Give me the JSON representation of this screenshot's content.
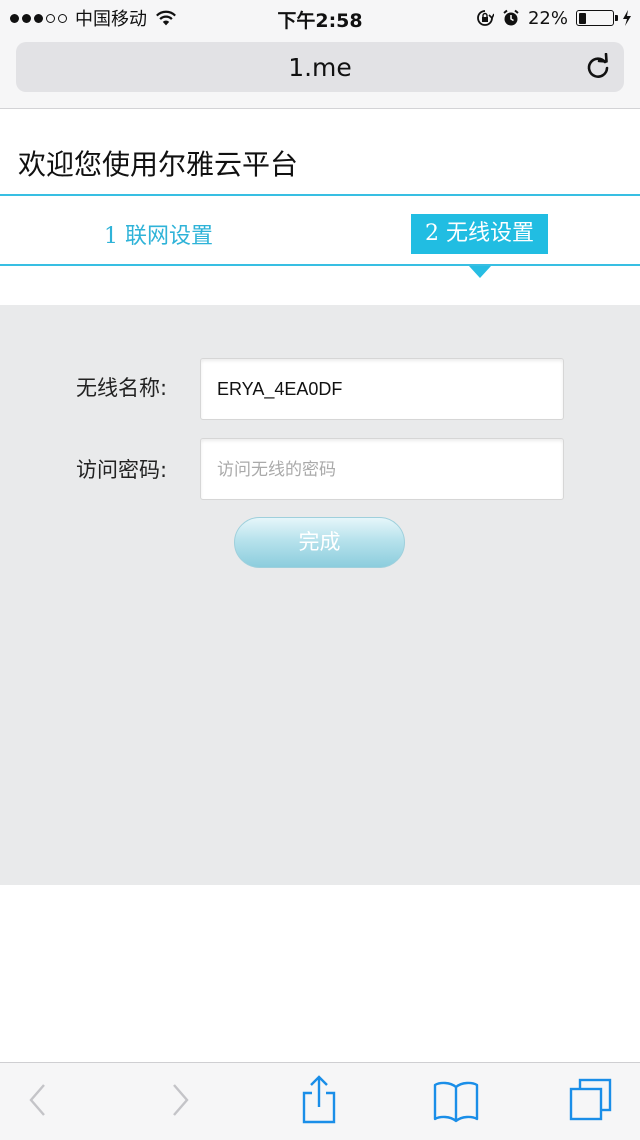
{
  "status_bar": {
    "carrier": "中国移动",
    "time": "下午2:58",
    "battery_percent": "22%",
    "battery_level": 0.22,
    "signal_bars_filled": 3,
    "signal_bars_total": 5
  },
  "browser": {
    "url": "1.me"
  },
  "page": {
    "welcome_title": "欢迎您使用尔雅云平台",
    "steps": [
      {
        "label": "1 联网设置",
        "active": false
      },
      {
        "label": "2  无线设置",
        "active": true
      }
    ],
    "form": {
      "ssid_label": "无线名称:",
      "ssid_value": "ERYA_4EA0DF",
      "password_label": "访问密码:",
      "password_placeholder": "访问无线的密码",
      "done_label": "完成"
    }
  },
  "colors": {
    "accent": "#21bde2",
    "panel_bg": "#e9eaeb",
    "toolbar_icon": "#1a8ee8"
  }
}
